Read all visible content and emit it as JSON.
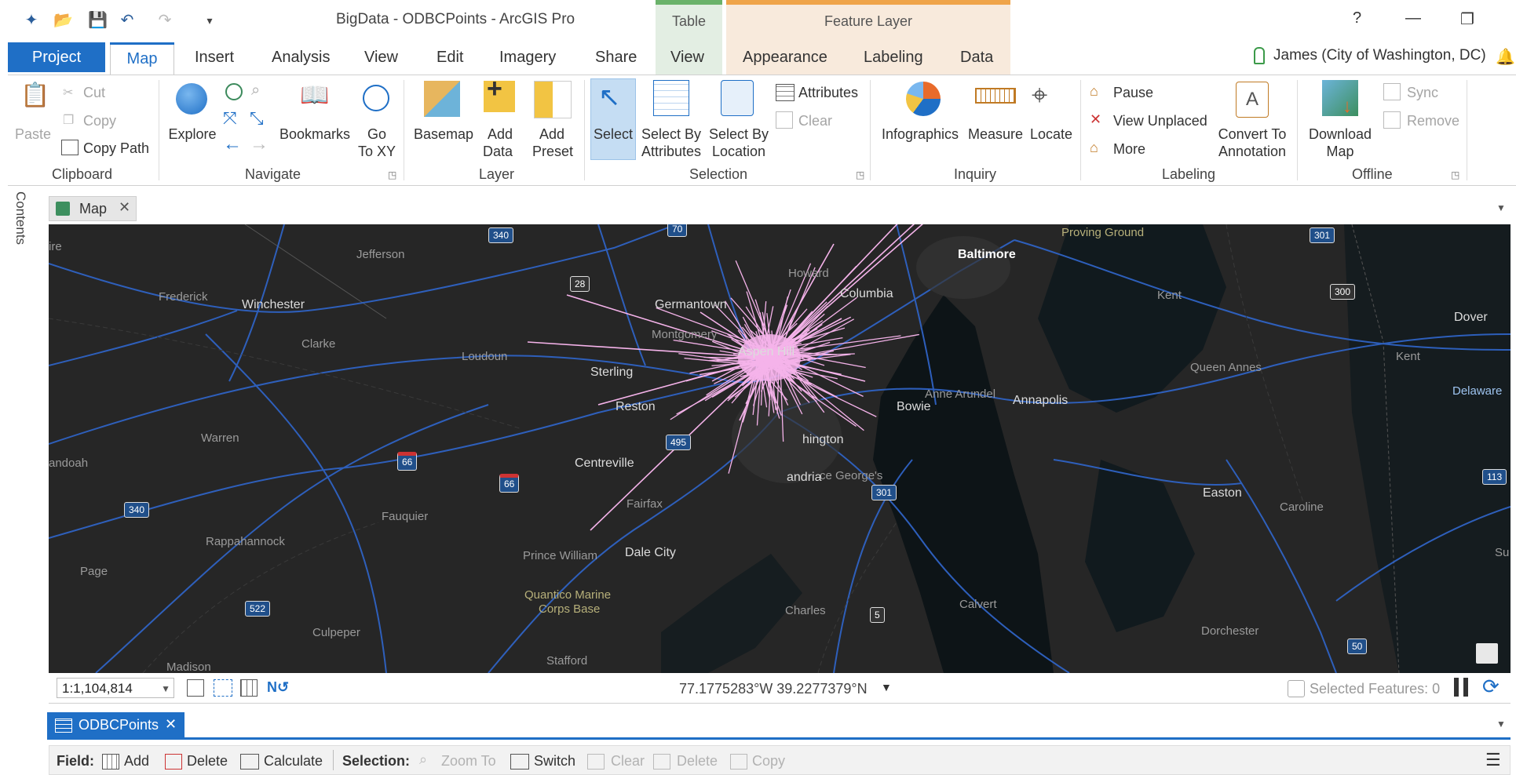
{
  "window": {
    "title": "BigData - ODBCPoints - ArcGIS Pro",
    "help": "?",
    "minimize": "—",
    "restore": "❐"
  },
  "context_tabs": {
    "table_header": "Table",
    "feature_header": "Feature Layer"
  },
  "tabs": [
    "Project",
    "Map",
    "Insert",
    "Analysis",
    "View",
    "Edit",
    "Imagery",
    "Share",
    "View",
    "Appearance",
    "Labeling",
    "Data"
  ],
  "user": "James (City of Washington, DC)",
  "ribbon": {
    "clipboard": {
      "label": "Clipboard",
      "paste": "Paste",
      "cut": "Cut",
      "copy": "Copy",
      "copy_path": "Copy Path"
    },
    "navigate": {
      "label": "Navigate",
      "explore": "Explore",
      "bookmarks": "Bookmarks",
      "go": "Go",
      "to_xy": "To XY"
    },
    "layer": {
      "label": "Layer",
      "basemap": "Basemap",
      "add": "Add",
      "data": "Data",
      "preset": "Preset"
    },
    "selection": {
      "label": "Selection",
      "select": "Select",
      "select_by": "Select By",
      "attributes": "Attributes",
      "location": "Location",
      "attributes_btn": "Attributes",
      "clear": "Clear"
    },
    "inquiry": {
      "label": "Inquiry",
      "infographics": "Infographics",
      "measure": "Measure",
      "locate": "Locate"
    },
    "labeling": {
      "label": "Labeling",
      "pause": "Pause",
      "view_unplaced": "View Unplaced",
      "more": "More",
      "convert_to": "Convert To",
      "annotation": "Annotation"
    },
    "offline": {
      "label": "Offline",
      "download": "Download",
      "map": "Map",
      "sync": "Sync",
      "remove": "Remove"
    }
  },
  "contents_label": "Contents",
  "map_tab": "Map",
  "map_labels": {
    "proving_ground": "Proving Ground",
    "baltimore": "Baltimore",
    "jefferson": "Jefferson",
    "howard": "Howard",
    "columbia": "Columbia",
    "frederick": "Frederick",
    "winchester": "Winchester",
    "germantown": "Germantown",
    "montgomery": "Montgomery",
    "clarke": "Clarke",
    "loudoun": "Loudoun",
    "aspen_hill": "Aspen Hill",
    "sterling": "Sterling",
    "reston": "Reston",
    "anne_arundel": "Anne Arundel",
    "annapolis": "Annapolis",
    "bowie": "Bowie",
    "kent": "Kent",
    "queen_annes": "Queen Annes",
    "kent2": "Kent",
    "dover": "Dover",
    "delaware": "Delaware",
    "warren": "Warren",
    "andoah": "andoah",
    "centreville": "Centreville",
    "washington": "hington",
    "prince_georges": "ce George's",
    "alexandria": "andria",
    "fairfax": "Fairfax",
    "fauquier": "Fauquier",
    "easton": "Easton",
    "caroline": "Caroline",
    "rappahannock": "Rappahannock",
    "prince_william": "Prince William",
    "dale_city": "Dale City",
    "page": "Page",
    "quantico": "Quantico Marine",
    "quantico2": "Corps Base",
    "charles": "Charles",
    "calvert": "Calvert",
    "dorchester": "Dorchester",
    "culpeper": "Culpeper",
    "madison": "Madison",
    "stafford": "Stafford",
    "ire": "ire",
    "su": "Su"
  },
  "shields": {
    "s340a": "340",
    "s70": "70",
    "s301a": "301",
    "s28": "28",
    "s300": "300",
    "s66a": "66",
    "s66b": "66",
    "s340b": "340",
    "s301b": "301",
    "s113": "113",
    "s522": "522",
    "s5": "5",
    "s50": "50",
    "s495": "495"
  },
  "status": {
    "scale": "1:1,104,814",
    "coordinates": "77.1775283°W 39.2277379°N",
    "selected_features": "Selected Features: 0"
  },
  "attribute_table": {
    "tab": "ODBCPoints",
    "field_label": "Field:",
    "add": "Add",
    "delete": "Delete",
    "calculate": "Calculate",
    "selection_label": "Selection:",
    "zoom_to": "Zoom To",
    "switch": "Switch",
    "clear": "Clear",
    "delete2": "Delete",
    "copy": "Copy"
  },
  "colors": {
    "accent": "#1f6fc6",
    "map_bg": "#262626",
    "roads": "#2f63c4",
    "spider": "#f5b3ea"
  }
}
